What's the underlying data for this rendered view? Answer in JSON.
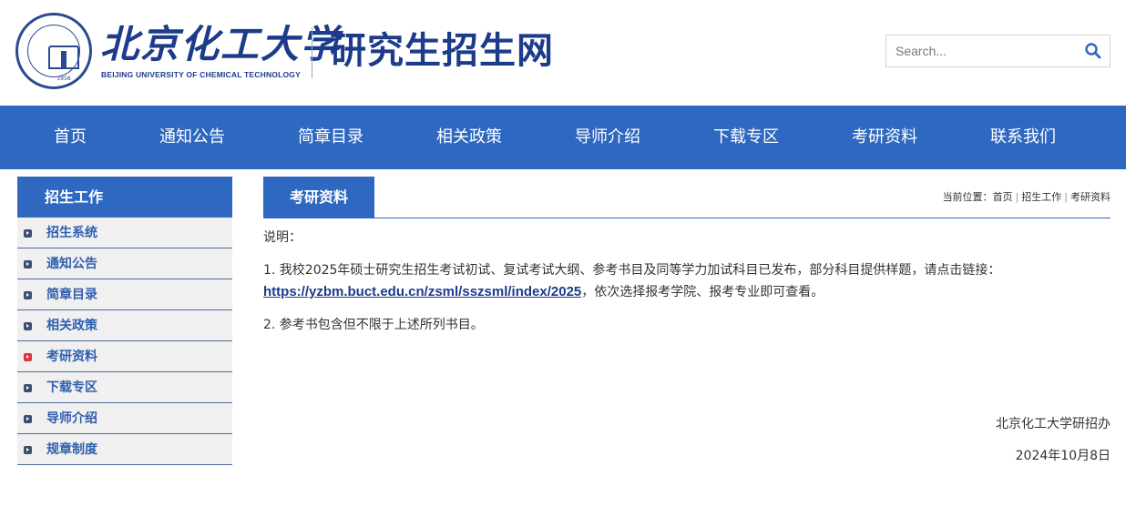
{
  "header": {
    "university_cn": "北京化工大学",
    "university_en": "BEIJING UNIVERSITY OF CHEMICAL TECHNOLOGY",
    "seal_year": "1958",
    "site_title": "研究生招生网",
    "search_placeholder": "Search..."
  },
  "nav": {
    "items": [
      "首页",
      "通知公告",
      "简章目录",
      "相关政策",
      "导师介绍",
      "下载专区",
      "考研资料",
      "联系我们"
    ]
  },
  "sidebar": {
    "title": "招生工作",
    "items": [
      {
        "label": "招生系统",
        "active": false
      },
      {
        "label": "通知公告",
        "active": false
      },
      {
        "label": "简章目录",
        "active": false
      },
      {
        "label": "相关政策",
        "active": false
      },
      {
        "label": "考研资料",
        "active": true
      },
      {
        "label": "下载专区",
        "active": false
      },
      {
        "label": "导师介绍",
        "active": false
      },
      {
        "label": "规章制度",
        "active": false
      }
    ]
  },
  "content": {
    "tab_title": "考研资料",
    "breadcrumb": {
      "prefix": "当前位置：",
      "home": "首页",
      "section": "招生工作",
      "current": "考研资料"
    },
    "intro": "说明：",
    "item1_text": "1. 我校2025年硕士研究生招生考试初试、复试考试大纲、参考书目及同等学力加试科目已发布，部分科目提供样题，请点击链接：",
    "item1_link": "https://yzbm.buct.edu.cn/zsml/sszsml/index/2025",
    "item1_suffix": "，依次选择报考学院、报考专业即可查看。",
    "item2_text": "2. 参考书包含但不限于上述所列书目。",
    "signature": "北京化工大学研招办",
    "date": "2024年10月8日"
  },
  "colors": {
    "brand_blue": "#2f68c0",
    "title_blue": "#1c3b8a",
    "active_bullet": "#d9363e"
  }
}
